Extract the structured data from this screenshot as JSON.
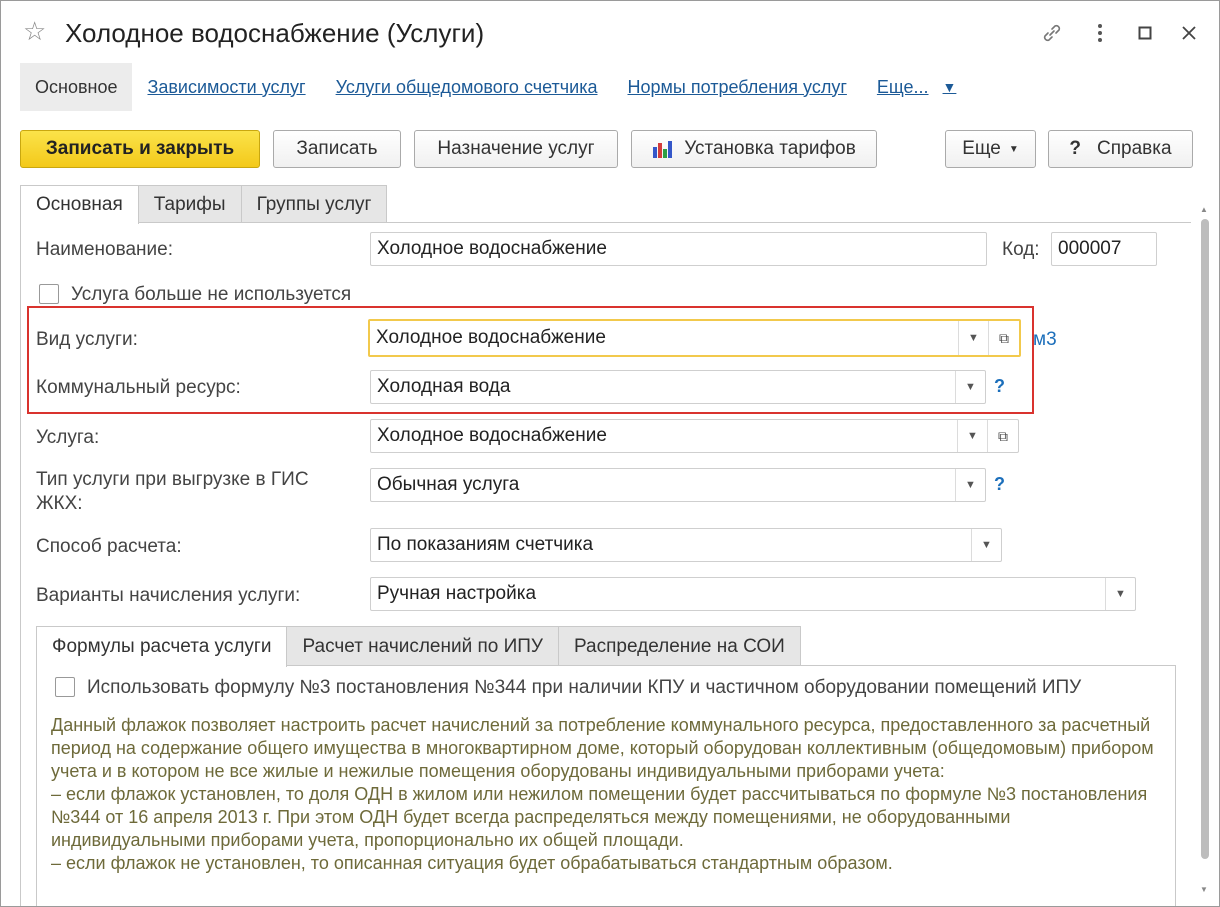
{
  "window": {
    "title": "Холодное водоснабжение (Услуги)"
  },
  "nav": [
    {
      "label": "Основное"
    },
    {
      "label": "Зависимости услуг"
    },
    {
      "label": "Услуги общедомового счетчика"
    },
    {
      "label": "Нормы потребления услуг"
    },
    {
      "label": "Еще..."
    }
  ],
  "toolbar": {
    "save_close": "Записать и закрыть",
    "save": "Записать",
    "assign": "Назначение услуг",
    "tariffs": "Установка тарифов",
    "more": "Еще",
    "help": "Справка"
  },
  "tabs": [
    "Основная",
    "Тарифы",
    "Группы услуг"
  ],
  "form": {
    "name_label": "Наименование:",
    "name_value": "Холодное водоснабжение",
    "code_label": "Код:",
    "code_value": "000007",
    "unused_label": "Услуга больше не используется",
    "kind_label": "Вид услуги:",
    "kind_value": "Холодное водоснабжение",
    "kind_unit": "м3",
    "resource_label": "Коммунальный ресурс:",
    "resource_value": "Холодная вода",
    "service_label": "Услуга:",
    "service_value": "Холодное водоснабжение",
    "gis_label": "Тип услуги при выгрузке в ГИС ЖКХ:",
    "gis_value": "Обычная услуга",
    "calc_label": "Способ расчета:",
    "calc_value": "По показаниям счетчика",
    "variants_label": "Варианты начисления услуги:",
    "variants_value": "Ручная настройка",
    "help_mark": "?"
  },
  "subtabs": [
    "Формулы расчета услуги",
    "Расчет начислений по ИПУ",
    "Распределение на СОИ"
  ],
  "formula": {
    "checkbox_label": "Использовать формулу №3 постановления №344 при наличии КПУ и частичном оборудовании помещений ИПУ",
    "description": "Данный флажок позволяет настроить расчет начислений за потребление коммунального ресурса, предоставленного за расчетный период на содержание общего имущества в многоквартирном доме, который оборудован коллективным (общедомовым) прибором учета и в котором не все жилые и нежилые помещения оборудованы индивидуальными приборами учета:\n– если флажок установлен, то доля ОДН в жилом или нежилом помещении будет рассчитываться по формуле №3 постановления №344 от 16 апреля 2013 г. При этом ОДН будет всегда распределяться между помещениями, не оборудованными индивидуальными приборами учета, пропорционально их общей площади.\n– если флажок не установлен, то описанная ситуация будет обрабатываться стандартным образом."
  },
  "colors": {
    "accent_yellow": "#f3c91a",
    "link_blue": "#1c5a97",
    "highlight_red": "#d9332e",
    "description_text": "#6e6a3a"
  }
}
